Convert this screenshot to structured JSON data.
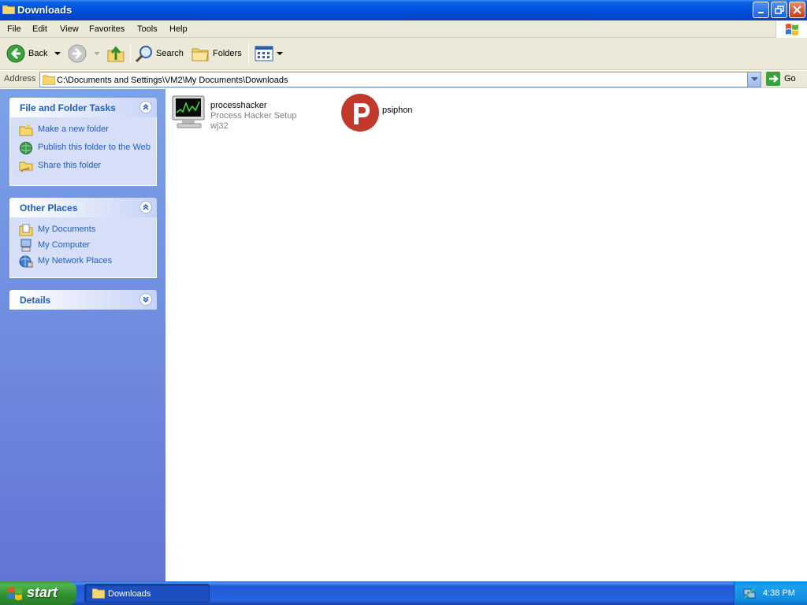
{
  "window": {
    "title": "Downloads"
  },
  "menu": {
    "items": [
      "File",
      "Edit",
      "View",
      "Favorites",
      "Tools",
      "Help"
    ]
  },
  "toolbar": {
    "back": "Back",
    "search": "Search",
    "folders": "Folders"
  },
  "address": {
    "label": "Address",
    "path": "C:\\Documents and Settings\\VM2\\My Documents\\Downloads",
    "go": "Go"
  },
  "sidebar": {
    "file_tasks": {
      "title": "File and Folder Tasks",
      "items": [
        {
          "label": "Make a new folder",
          "icon": "new-folder-icon"
        },
        {
          "label": "Publish this folder to the Web",
          "icon": "publish-web-icon"
        },
        {
          "label": "Share this folder",
          "icon": "share-folder-icon"
        }
      ]
    },
    "other_places": {
      "title": "Other Places",
      "items": [
        {
          "label": "My Documents",
          "icon": "my-documents-icon"
        },
        {
          "label": "My Computer",
          "icon": "my-computer-icon"
        },
        {
          "label": "My Network Places",
          "icon": "network-places-icon"
        }
      ]
    },
    "details": {
      "title": "Details"
    }
  },
  "files": [
    {
      "name": "processhacker",
      "description": "Process Hacker Setup",
      "company": "wj32",
      "icon": "process-hacker-icon"
    },
    {
      "name": "psiphon",
      "icon": "psiphon-icon"
    }
  ],
  "taskbar": {
    "start": "start",
    "task": "Downloads",
    "clock": "4:38 PM"
  },
  "colors": {
    "title_blue": "#0054e3",
    "sidebar_link": "#215dc6",
    "start_green": "#3c9b3c",
    "psiphon_red": "#c0392b"
  }
}
